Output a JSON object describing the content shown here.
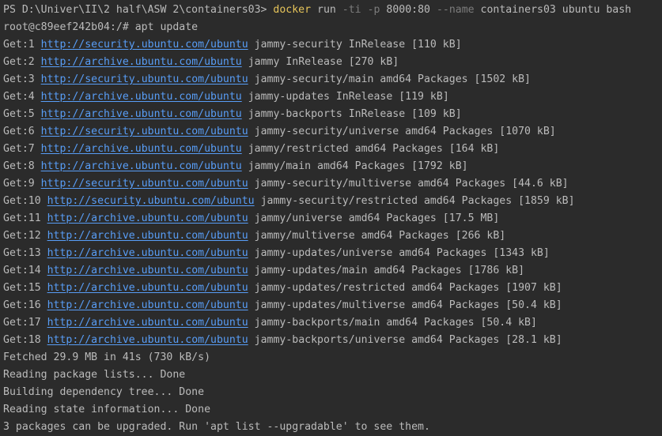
{
  "ps_line": {
    "prompt": "PS D:\\Univer\\II\\2 half\\ASW 2\\containers03>",
    "cmd": "docker",
    "arg1": "run",
    "flag1": "-ti",
    "flag2": "-p",
    "arg2": "8000:80",
    "flag3": "--name",
    "arg3": "containers03 ubuntu bash"
  },
  "root_line": "root@c89eef242b04:/# apt update",
  "get_lines": [
    {
      "prefix": "Get:1",
      "url": "http://security.ubuntu.com/ubuntu",
      "rest": "jammy-security InRelease [110 kB]"
    },
    {
      "prefix": "Get:2",
      "url": "http://archive.ubuntu.com/ubuntu",
      "rest": "jammy InRelease [270 kB]"
    },
    {
      "prefix": "Get:3",
      "url": "http://security.ubuntu.com/ubuntu",
      "rest": "jammy-security/main amd64 Packages [1502 kB]"
    },
    {
      "prefix": "Get:4",
      "url": "http://archive.ubuntu.com/ubuntu",
      "rest": "jammy-updates InRelease [119 kB]"
    },
    {
      "prefix": "Get:5",
      "url": "http://archive.ubuntu.com/ubuntu",
      "rest": "jammy-backports InRelease [109 kB]"
    },
    {
      "prefix": "Get:6",
      "url": "http://security.ubuntu.com/ubuntu",
      "rest": "jammy-security/universe amd64 Packages [1070 kB]"
    },
    {
      "prefix": "Get:7",
      "url": "http://archive.ubuntu.com/ubuntu",
      "rest": "jammy/restricted amd64 Packages [164 kB]"
    },
    {
      "prefix": "Get:8",
      "url": "http://archive.ubuntu.com/ubuntu",
      "rest": "jammy/main amd64 Packages [1792 kB]"
    },
    {
      "prefix": "Get:9",
      "url": "http://security.ubuntu.com/ubuntu",
      "rest": "jammy-security/multiverse amd64 Packages [44.6 kB]"
    },
    {
      "prefix": "Get:10",
      "url": "http://security.ubuntu.com/ubuntu",
      "rest": "jammy-security/restricted amd64 Packages [1859 kB]"
    },
    {
      "prefix": "Get:11",
      "url": "http://archive.ubuntu.com/ubuntu",
      "rest": "jammy/universe amd64 Packages [17.5 MB]"
    },
    {
      "prefix": "Get:12",
      "url": "http://archive.ubuntu.com/ubuntu",
      "rest": "jammy/multiverse amd64 Packages [266 kB]"
    },
    {
      "prefix": "Get:13",
      "url": "http://archive.ubuntu.com/ubuntu",
      "rest": "jammy-updates/universe amd64 Packages [1343 kB]"
    },
    {
      "prefix": "Get:14",
      "url": "http://archive.ubuntu.com/ubuntu",
      "rest": "jammy-updates/main amd64 Packages [1786 kB]"
    },
    {
      "prefix": "Get:15",
      "url": "http://archive.ubuntu.com/ubuntu",
      "rest": "jammy-updates/restricted amd64 Packages [1907 kB]"
    },
    {
      "prefix": "Get:16",
      "url": "http://archive.ubuntu.com/ubuntu",
      "rest": "jammy-updates/multiverse amd64 Packages [50.4 kB]"
    },
    {
      "prefix": "Get:17",
      "url": "http://archive.ubuntu.com/ubuntu",
      "rest": "jammy-backports/main amd64 Packages [50.4 kB]"
    },
    {
      "prefix": "Get:18",
      "url": "http://archive.ubuntu.com/ubuntu",
      "rest": "jammy-backports/universe amd64 Packages [28.1 kB]"
    }
  ],
  "tail_lines": [
    "Fetched 29.9 MB in 41s (730 kB/s)",
    "Reading package lists... Done",
    "Building dependency tree... Done",
    "Reading state information... Done",
    "3 packages can be upgraded. Run 'apt list --upgradable' to see them."
  ],
  "colors": {
    "background": "#2b2b2b",
    "text": "#bbbbbb",
    "command": "#e6c45a",
    "flag": "#7c7c7c",
    "link": "#589df6"
  }
}
